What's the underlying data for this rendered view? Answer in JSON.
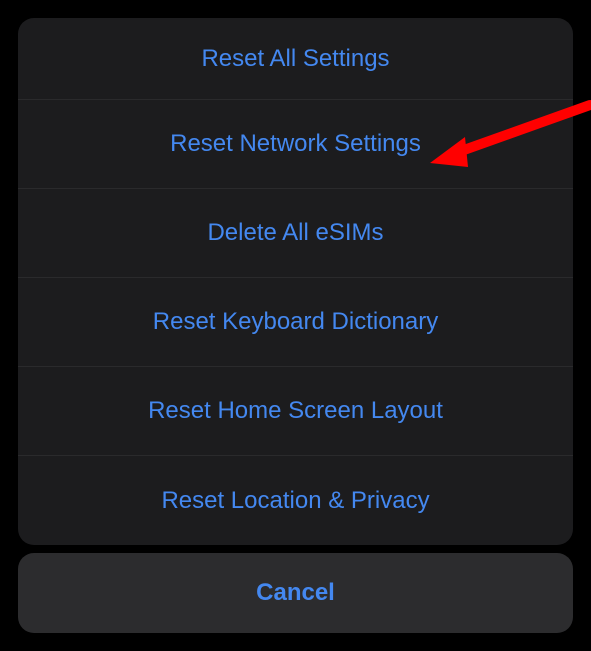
{
  "actionSheet": {
    "options": [
      {
        "label": "Reset All Settings",
        "name": "reset-all-settings-option"
      },
      {
        "label": "Reset Network Settings",
        "name": "reset-network-settings-option"
      },
      {
        "label": "Delete All eSIMs",
        "name": "delete-all-esims-option"
      },
      {
        "label": "Reset Keyboard Dictionary",
        "name": "reset-keyboard-dictionary-option"
      },
      {
        "label": "Reset Home Screen Layout",
        "name": "reset-home-screen-layout-option"
      },
      {
        "label": "Reset Location & Privacy",
        "name": "reset-location-privacy-option"
      }
    ],
    "cancelLabel": "Cancel"
  },
  "backgroundText": "Reset",
  "annotation": {
    "type": "arrow",
    "color": "#ff0000",
    "pointsTo": "reset-network-settings-option"
  }
}
